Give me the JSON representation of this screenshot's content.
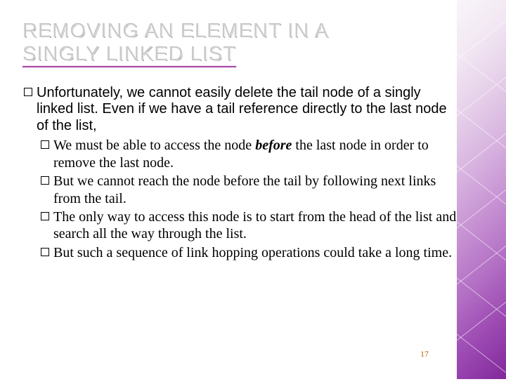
{
  "title": {
    "line1": "REMOVING AN ELEMENT IN A",
    "line2": "SINGLY LINKED LIST"
  },
  "lead": "Unfortunately, we cannot easily delete the tail node of a singly linked list. Even if we have a tail reference directly to the last node of the list,",
  "sub": [
    {
      "pre": "We must be able to access the node ",
      "em": "before",
      "post": " the last node in order to remove the last node."
    },
    {
      "pre": "But we cannot reach the node before the tail by following next links from the tail.",
      "em": "",
      "post": ""
    },
    {
      "pre": "The only way to access this node is to start from the head of the list and search all the way through the list.",
      "em": "",
      "post": ""
    },
    {
      "pre": "But such a sequence of link hopping operations could take a long time.",
      "em": "",
      "post": ""
    }
  ],
  "page_number": "17"
}
